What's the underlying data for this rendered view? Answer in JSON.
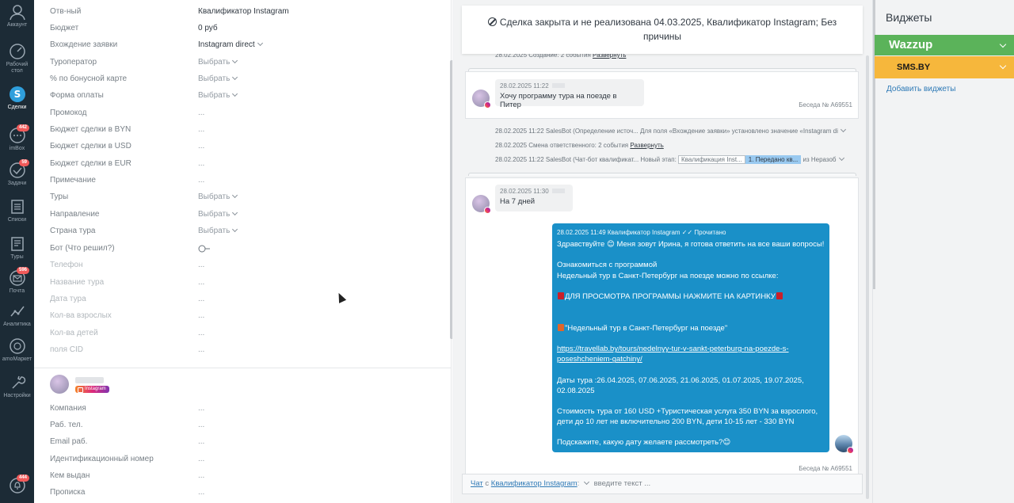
{
  "nav": {
    "account": "Аккаунт",
    "desktop": "Рабочий стол",
    "deals": "Сделки",
    "inbox": "imBox",
    "inbox_badge": "442",
    "tasks": "Задачи",
    "tasks_badge": "59",
    "lists": "Списки",
    "tours": "Туры",
    "mail": "Почта",
    "mail_badge": "596",
    "analytics": "Аналитика",
    "market": "amoМаркет",
    "settings": "Настройки",
    "bottom_badge": "444"
  },
  "fields": [
    {
      "label": "Отв-ный",
      "value": "Квалификатор Instagram"
    },
    {
      "label": "Бюджет",
      "value": "0 руб"
    },
    {
      "label": "Вхождение заявки",
      "value": "Instagram direct"
    },
    {
      "label": "Туроператор",
      "value": "Выбрать"
    },
    {
      "label": "% по бонусной карте",
      "value": "Выбрать"
    },
    {
      "label": "Форма оплаты",
      "value": "Выбрать"
    },
    {
      "label": "Промокод",
      "value": "..."
    },
    {
      "label": "Бюджет сделки в BYN",
      "value": "..."
    },
    {
      "label": "Бюджет сделки в USD",
      "value": "..."
    },
    {
      "label": "Бюджет сделки в EUR",
      "value": "..."
    },
    {
      "label": "Примечание",
      "value": "..."
    },
    {
      "label": "Туры",
      "value": "Выбрать"
    },
    {
      "label": "Направление",
      "value": "Выбрать"
    },
    {
      "label": "Страна тура",
      "value": "Выбрать"
    },
    {
      "label": "Бот (Что решил?)",
      "value": ""
    },
    {
      "label": "Телефон",
      "value": "..."
    },
    {
      "label": "Название тура",
      "value": "..."
    },
    {
      "label": "Дата тура",
      "value": "..."
    },
    {
      "label": "Кол-ва взрослых",
      "value": "..."
    },
    {
      "label": "Кол-ва детей",
      "value": "..."
    },
    {
      "label": "поля CID",
      "value": "..."
    }
  ],
  "contact": {
    "tag": "Instagram",
    "fields": [
      {
        "label": "Компания",
        "value": "..."
      },
      {
        "label": "Раб. тел.",
        "value": "..."
      },
      {
        "label": "Email раб.",
        "value": "..."
      },
      {
        "label": "Идентификационный номер",
        "value": "..."
      },
      {
        "label": "Кем выдан",
        "value": "..."
      },
      {
        "label": "Прописка",
        "value": "..."
      }
    ]
  },
  "chat": {
    "closed_banner": "Сделка закрыта и не реализована 04.03.2025, Квалификатор Instagram; Без причины",
    "event_top": "28.02.2025 Создание: 2 события",
    "event_top_link": "Развернуть",
    "msg1_meta": "28.02.2025 11:22",
    "msg1_text": "Хочу программу тура на поезде в Питер",
    "conv1": "Беседа № A69551",
    "event2": "28.02.2025 11:22 SalesBot (Определение источ... Для поля «Вхождение заявки» установлено значение «Instagram di",
    "event3": "28.02.2025 Смена ответственного: 2 события",
    "event3_link": "Развернуть",
    "event4_prefix": "28.02.2025 11:22 SalesBot (Чат-бот квалификат... Новый этап:",
    "event4_stage1": "Квалификация Inst...",
    "event4_stage2": "1. Передано кв...",
    "event4_suffix": "из Неразоб",
    "msg2_meta": "28.02.2025 11:30",
    "msg2_text": "На 7 дней",
    "out_meta": "28.02.2025 11:49 Квалификатор Instagram ✓✓ Прочитано",
    "out_p1": "Здравствуйте 😊 Меня зовут Ирина, я готова ответить на все ваши вопросы!",
    "out_p2": "Ознакомиться с программой\nНедельный тур в Санкт-Петербург на поезде можно по ссылке:",
    "out_p3": "ДЛЯ ПРОСМОТРА ПРОГРАММЫ НАЖМИТЕ НА КАРТИНКУ",
    "out_p4": "\"Недельный тур в Санкт-Петербург на поезде\"",
    "out_link": "https://travellab.by/tours/nedelnyy-tur-v-sankt-peterburg-na-poezde-s-poseshcheniem-gatchiny/",
    "out_p5": "Даты тура :26.04.2025, 07.06.2025, 21.06.2025, 01.07.2025, 19.07.2025, 02.08.2025",
    "out_p6": "Стоимость тура от 160 USD +Туристическая услуга 350 BYN за взрослого, дети до 10 лет не включительно 200 BYN, дети 10-15 лет - 330 BYN",
    "out_p7": "Подскажите, какую дату желаете рассмотреть?😊",
    "conv2": "Беседа № A69551",
    "input_chat": "Чат",
    "input_with": "с",
    "input_to": "Квалификатор Instagram",
    "input_placeholder": "введите текст ..."
  },
  "widgets": {
    "title": "Виджеты",
    "wazzup": "Wazzup",
    "sms": "SMS.BY",
    "add": "Добавить виджеты",
    "wazzup_color": "#5bb35a",
    "sms_color": "#f6b73c"
  }
}
